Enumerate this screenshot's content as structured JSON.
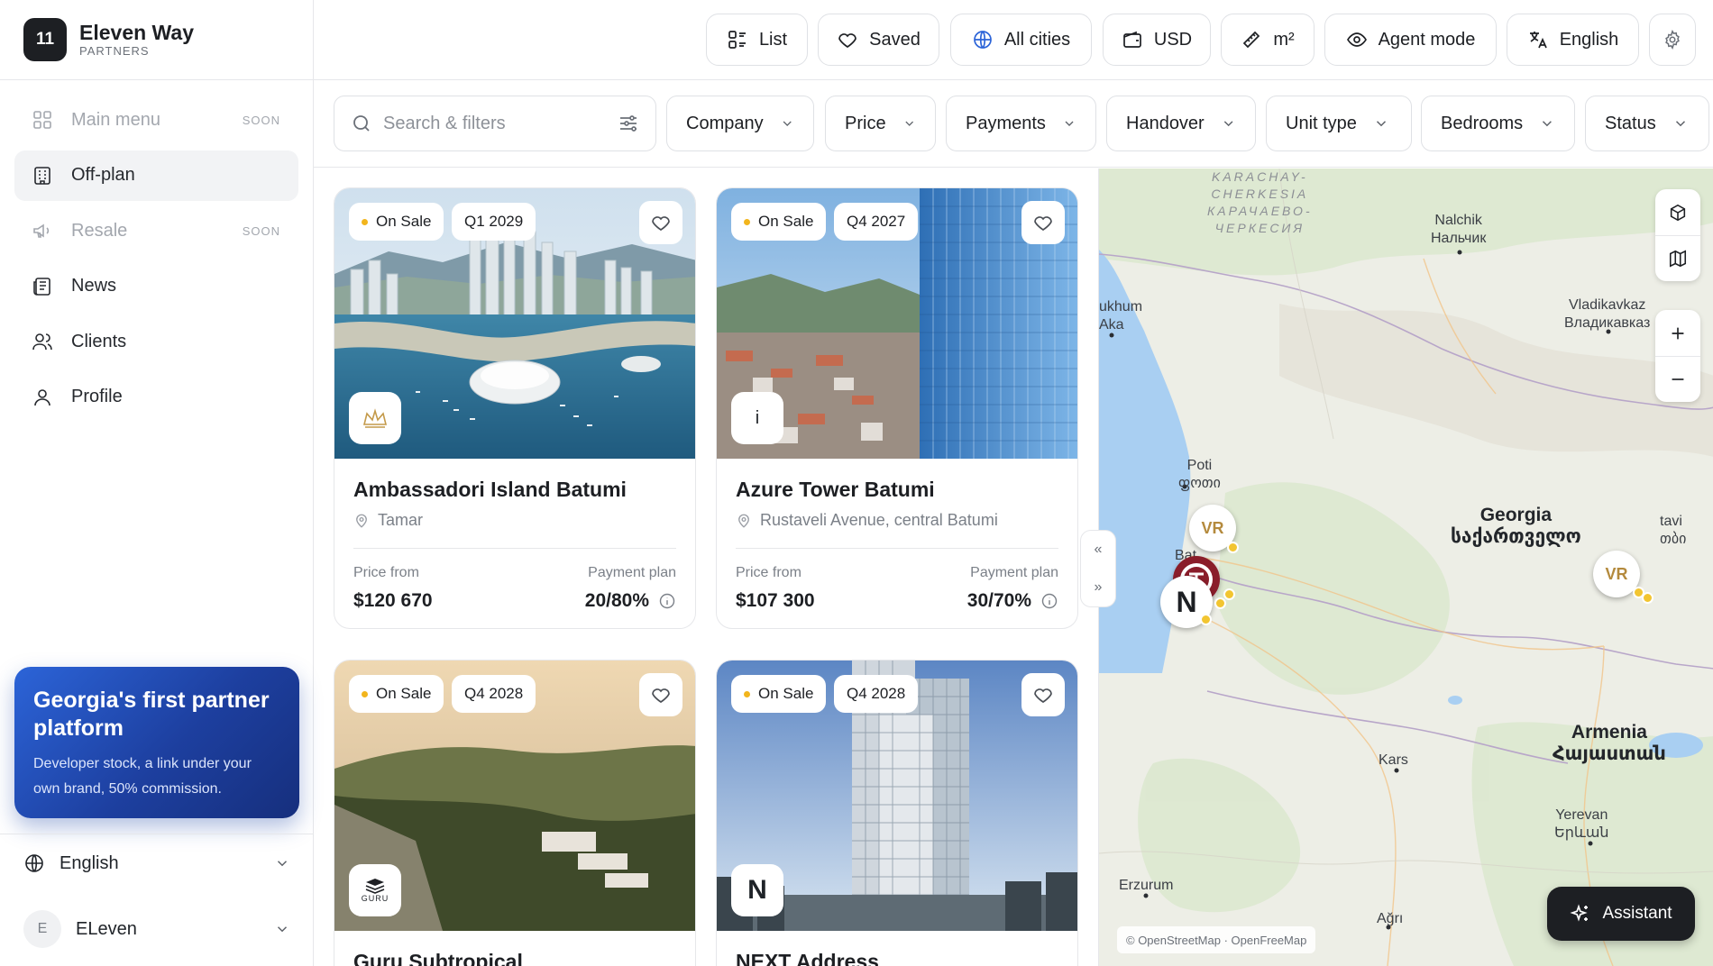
{
  "brand": {
    "logo_text": "11",
    "name": "Eleven Way",
    "sub": "PARTNERS"
  },
  "sidebar": {
    "items": [
      {
        "label": "Main menu",
        "icon": "grid-icon",
        "soon": "SOON"
      },
      {
        "label": "Off-plan",
        "icon": "building-icon"
      },
      {
        "label": "Resale",
        "icon": "megaphone-icon",
        "soon": "SOON"
      },
      {
        "label": "News",
        "icon": "newspaper-icon"
      },
      {
        "label": "Clients",
        "icon": "users-icon"
      },
      {
        "label": "Profile",
        "icon": "user-icon"
      }
    ],
    "promo": {
      "title": "Georgia's first partner platform",
      "text": "Developer stock, a link under your own brand, 50% commission."
    },
    "language": "English",
    "user": {
      "initial": "E",
      "name": "ELeven"
    }
  },
  "topbar": {
    "list": "List",
    "saved": "Saved",
    "cities": "All cities",
    "currency": "USD",
    "unit": "m²",
    "agent": "Agent mode",
    "language": "English"
  },
  "filters": {
    "search_placeholder": "Search & filters",
    "company": "Company",
    "price": "Price",
    "payments": "Payments",
    "handover": "Handover",
    "unit_type": "Unit type",
    "bedrooms": "Bedrooms",
    "status": "Status"
  },
  "cards": [
    {
      "status": "On Sale",
      "quarter": "Q1 2029",
      "title": "Ambassadori Island Batumi",
      "location": "Tamar",
      "price_label": "Price from",
      "price": "$120 670",
      "plan_label": "Payment plan",
      "plan": "20/80%",
      "dev_logo": ""
    },
    {
      "status": "On Sale",
      "quarter": "Q4 2027",
      "title": "Azure Tower Batumi",
      "location": "Rustaveli Avenue, central Batumi",
      "price_label": "Price from",
      "price": "$107 300",
      "plan_label": "Payment plan",
      "plan": "30/70%",
      "dev_logo": "i"
    },
    {
      "status": "On Sale",
      "quarter": "Q4 2028",
      "title": "Guru Subtropical",
      "dev_logo": "GURU"
    },
    {
      "status": "On Sale",
      "quarter": "Q4 2028",
      "title": "NEXT Address",
      "dev_logo": "N"
    }
  ],
  "map": {
    "labels": {
      "karachay": "KARACHAY-\nCHERKESIA\nКАРАЧАЕВО-\nЧЕРКЕСИЯ",
      "nalchik": "Nalchik\nНальчик",
      "vladikavkaz": "Vladikavkaz\nВладикавказ",
      "sukhum": "ukhum\nAka",
      "poti": "Poti\nფოთი",
      "batumi": "Bat",
      "tbilisi": "tavi\nთბი",
      "georgia": "Georgia\nსაქართველო",
      "armenia": "Armenia\nՀայաստան",
      "kars": "Kars",
      "yerevan": "Yerevan\nԵրևան",
      "erzurum": "Erzurum",
      "agri": "Ağrı"
    },
    "attribution": "© OpenStreetMap · OpenFreeMap",
    "assistant": "Assistant",
    "pins": [
      "VR",
      "VR",
      "N"
    ]
  },
  "colors": {
    "accent_badge_dot": "#f2b51d",
    "promo_blue": "#2c64d8",
    "dark": "#1d1f23"
  }
}
